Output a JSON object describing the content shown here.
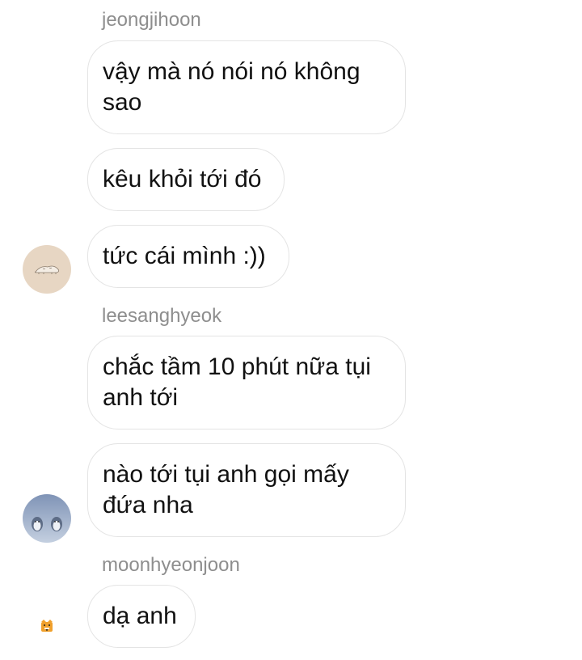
{
  "conversation": {
    "groups": [
      {
        "sender": "jeongjihoon",
        "avatar_icon": "sleeping-animal-avatar-icon",
        "messages": [
          "vậy mà nó nói nó không sao",
          "kêu khỏi tới đó",
          "tức cái mình :))"
        ]
      },
      {
        "sender": "leesanghyeok",
        "avatar_icon": "penguins-avatar-icon",
        "messages": [
          "chắc tầm 10 phút nữa tụi anh tới",
          "nào tới tụi anh gọi mấy đứa nha"
        ]
      },
      {
        "sender": "moonhyeonjoon",
        "avatar_icon": "tiger-emoji-avatar-icon",
        "messages": [
          "dạ anh"
        ]
      }
    ]
  },
  "colors": {
    "background": "#ffffff",
    "bubble_border": "#e4e4e4",
    "sender_text": "#8e8e8e",
    "message_text": "#111111"
  }
}
